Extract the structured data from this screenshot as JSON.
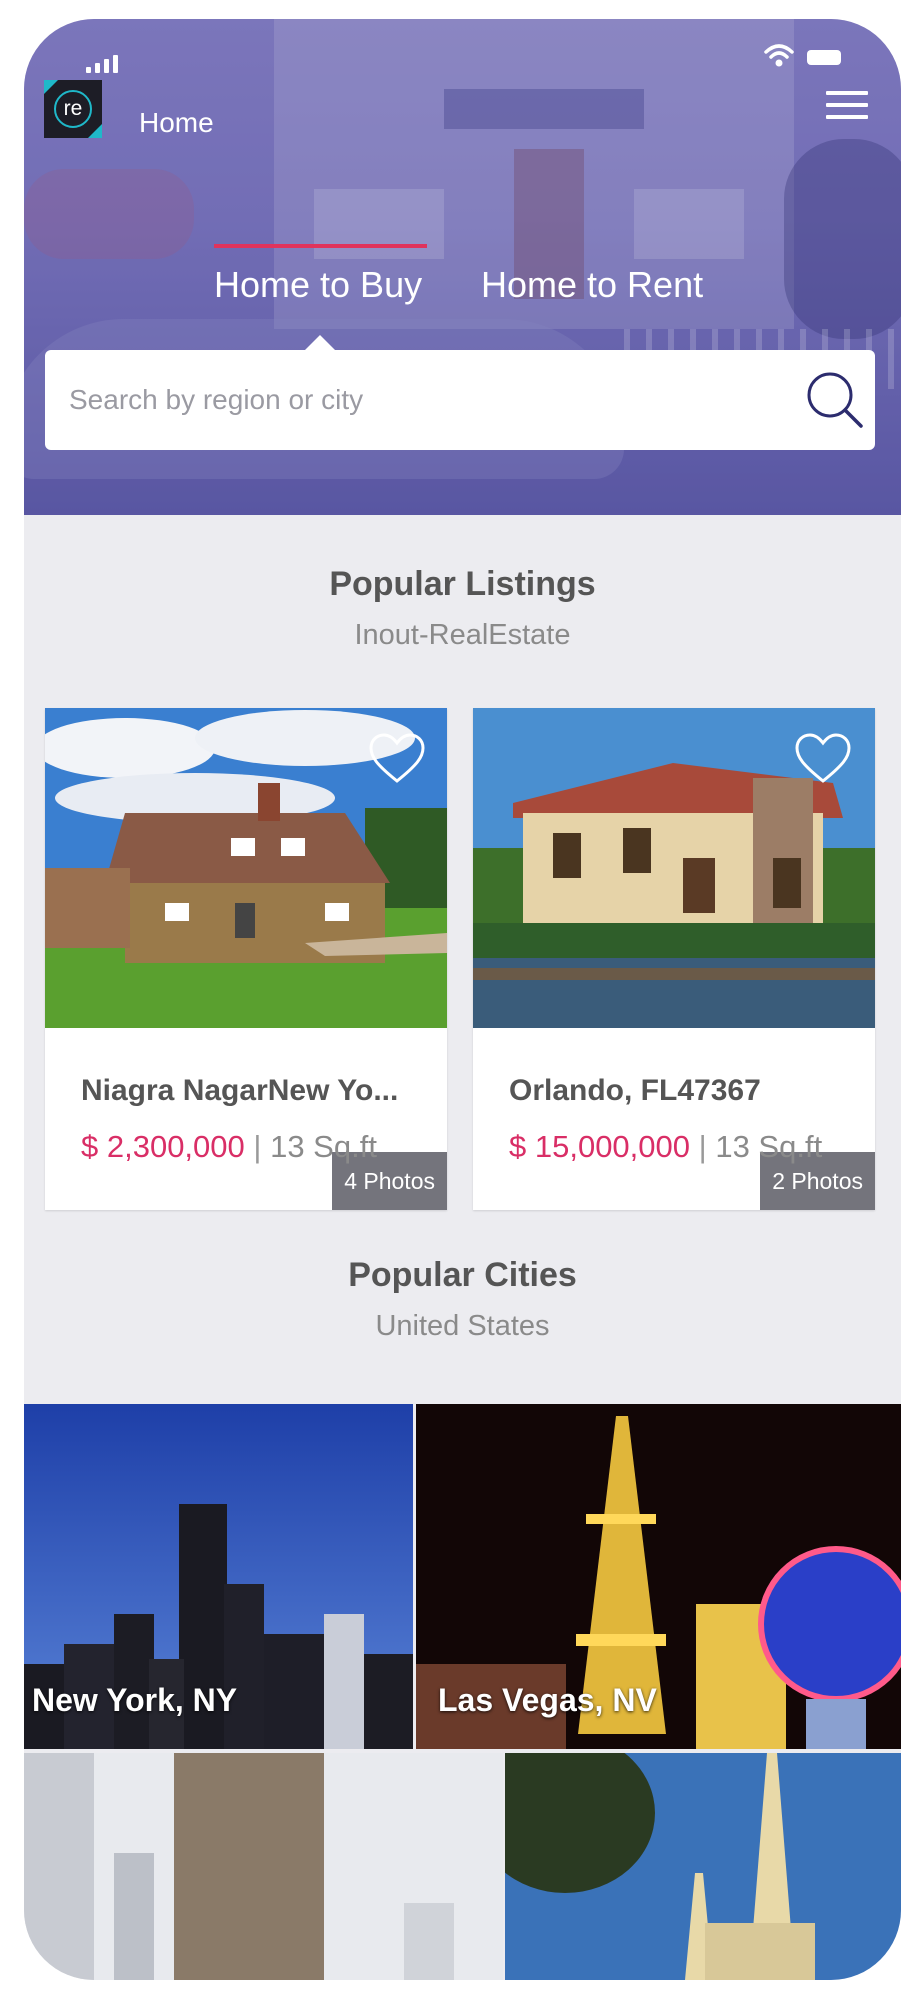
{
  "header": {
    "title": "Home",
    "logo_text": "re",
    "tabs": [
      {
        "label": "Home to Buy",
        "active": true
      },
      {
        "label": "Home to Rent",
        "active": false
      }
    ],
    "search": {
      "placeholder": "Search by region or city"
    },
    "accent_color": "#e0335c"
  },
  "popular_listings": {
    "title": "Popular Listings",
    "subtitle": "Inout-RealEstate",
    "items": [
      {
        "name": "Niagra NagarNew Yo...",
        "price": "$ 2,300,000",
        "separator": "|",
        "area": "13 Sq.ft",
        "photos": "4 Photos"
      },
      {
        "name": "Orlando, FL47367",
        "price": "$ 15,000,000",
        "separator": "|",
        "area": "13 Sq.ft",
        "photos": "2 Photos"
      }
    ],
    "price_color": "#d92e66"
  },
  "popular_cities": {
    "title": "Popular Cities",
    "subtitle": "United States",
    "items": [
      {
        "label": "New York, NY"
      },
      {
        "label": "Las Vegas, NV"
      },
      {
        "label": ""
      },
      {
        "label": ""
      }
    ]
  }
}
